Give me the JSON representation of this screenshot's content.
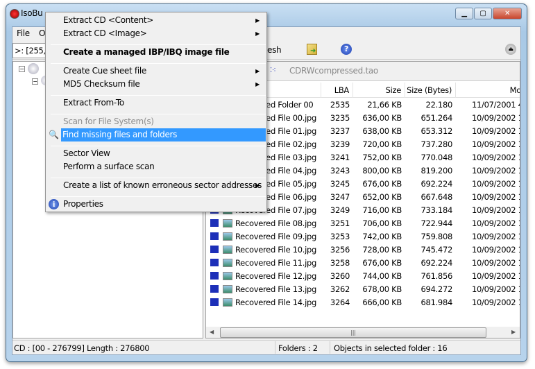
{
  "window": {
    "title": "IsoBu",
    "menubar": [
      "File",
      "O"
    ],
    "address": ">: [255,0"
  },
  "toolbar": {
    "refresh_partial": "esh"
  },
  "path": {
    "filename": "CDRWcompressed.tao"
  },
  "columns": [
    "LBA",
    "Size",
    "Size (Bytes)",
    "Mo"
  ],
  "rows": [
    {
      "name": "Recovered Folder 00",
      "lba": "2535",
      "size": "21,66 KB",
      "bytes": "22.180",
      "modified": "11/07/2001 4",
      "type": "folder"
    },
    {
      "name": "Recovered File 00.jpg",
      "lba": "3235",
      "size": "636,00 KB",
      "bytes": "651.264",
      "modified": "10/09/2002 14",
      "type": "jpg"
    },
    {
      "name": "Recovered File 01.jpg",
      "lba": "3237",
      "size": "638,00 KB",
      "bytes": "653.312",
      "modified": "10/09/2002 14",
      "type": "jpg"
    },
    {
      "name": "Recovered File 02.jpg",
      "lba": "3239",
      "size": "720,00 KB",
      "bytes": "737.280",
      "modified": "10/09/2002 14",
      "type": "jpg"
    },
    {
      "name": "Recovered File 03.jpg",
      "lba": "3241",
      "size": "752,00 KB",
      "bytes": "770.048",
      "modified": "10/09/2002 14",
      "type": "jpg"
    },
    {
      "name": "Recovered File 04.jpg",
      "lba": "3243",
      "size": "800,00 KB",
      "bytes": "819.200",
      "modified": "10/09/2002 14",
      "type": "jpg"
    },
    {
      "name": "Recovered File 05.jpg",
      "lba": "3245",
      "size": "676,00 KB",
      "bytes": "692.224",
      "modified": "10/09/2002 15",
      "type": "jpg"
    },
    {
      "name": "Recovered File 06.jpg",
      "lba": "3247",
      "size": "652,00 KB",
      "bytes": "667.648",
      "modified": "10/09/2002 16",
      "type": "jpg"
    },
    {
      "name": "Recovered File 07.jpg",
      "lba": "3249",
      "size": "716,00 KB",
      "bytes": "733.184",
      "modified": "10/09/2002 16",
      "type": "jpg"
    },
    {
      "name": "Recovered File 08.jpg",
      "lba": "3251",
      "size": "706,00 KB",
      "bytes": "722.944",
      "modified": "10/09/2002 17",
      "type": "jpg"
    },
    {
      "name": "Recovered File 09.jpg",
      "lba": "3253",
      "size": "742,00 KB",
      "bytes": "759.808",
      "modified": "10/09/2002 17",
      "type": "jpg"
    },
    {
      "name": "Recovered File 10.jpg",
      "lba": "3256",
      "size": "728,00 KB",
      "bytes": "745.472",
      "modified": "10/09/2002 17",
      "type": "jpg"
    },
    {
      "name": "Recovered File 11.jpg",
      "lba": "3258",
      "size": "676,00 KB",
      "bytes": "692.224",
      "modified": "10/09/2002 19",
      "type": "jpg"
    },
    {
      "name": "Recovered File 12.jpg",
      "lba": "3260",
      "size": "744,00 KB",
      "bytes": "761.856",
      "modified": "10/09/2002 19",
      "type": "jpg"
    },
    {
      "name": "Recovered File 13.jpg",
      "lba": "3262",
      "size": "678,00 KB",
      "bytes": "694.272",
      "modified": "10/09/2002 19",
      "type": "jpg"
    },
    {
      "name": "Recovered File 14.jpg",
      "lba": "3264",
      "size": "666,00 KB",
      "bytes": "681.984",
      "modified": "10/09/2002 19",
      "type": "jpg"
    }
  ],
  "status": {
    "cd": "CD : [00 - 276799]  Length : 276800",
    "folders": "Folders : 2",
    "objects": "Objects in selected folder : 16"
  },
  "context_menu": [
    {
      "label": "Extract CD  <Content>",
      "submenu": true
    },
    {
      "label": "Extract CD  <Image>",
      "submenu": true
    },
    {
      "sep": true
    },
    {
      "label": "Create a managed IBP/IBQ image file",
      "bold": true
    },
    {
      "sep": true
    },
    {
      "label": "Create Cue sheet file",
      "submenu": true
    },
    {
      "label": "MD5 Checksum file",
      "submenu": true
    },
    {
      "sep": true
    },
    {
      "label": "Extract From-To"
    },
    {
      "sep": true
    },
    {
      "label": "Scan for File System(s)",
      "disabled": true
    },
    {
      "label": "Find missing files and folders",
      "highlighted": true,
      "icon": "magnifier-icon"
    },
    {
      "sep": true
    },
    {
      "label": "Sector View"
    },
    {
      "label": "Perform a surface scan"
    },
    {
      "sep": true
    },
    {
      "label": "Create a list of known erroneous sector addresses",
      "submenu": true
    },
    {
      "sep": true
    },
    {
      "label": "Properties",
      "icon": "info-icon"
    }
  ],
  "colors": {
    "highlight": "#3399ff",
    "file_icon": "#1c2fb8"
  }
}
